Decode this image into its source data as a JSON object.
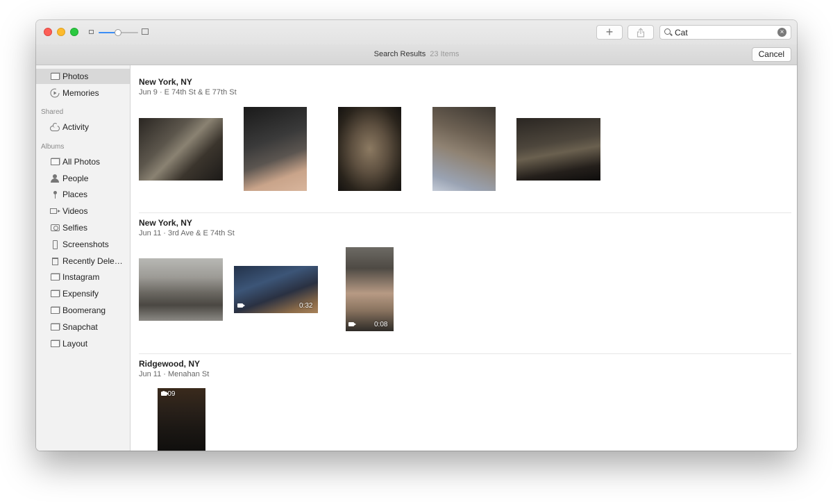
{
  "search": {
    "value": "Cat"
  },
  "header": {
    "title": "Search Results",
    "count": "23 Items",
    "cancel_label": "Cancel"
  },
  "toolbar": {
    "add_label": "+"
  },
  "sidebar": {
    "top_items": [
      {
        "label": "Photos",
        "icon": "album-icon"
      },
      {
        "label": "Memories",
        "icon": "memories-icon"
      }
    ],
    "shared_header": "Shared",
    "shared_items": [
      {
        "label": "Activity",
        "icon": "cloud-icon"
      }
    ],
    "albums_header": "Albums",
    "album_items": [
      {
        "label": "All Photos",
        "icon": "album-icon"
      },
      {
        "label": "People",
        "icon": "person-icon"
      },
      {
        "label": "Places",
        "icon": "pin-icon"
      },
      {
        "label": "Videos",
        "icon": "video-icon"
      },
      {
        "label": "Selfies",
        "icon": "camera-icon"
      },
      {
        "label": "Screenshots",
        "icon": "phone-icon"
      },
      {
        "label": "Recently Dele…",
        "icon": "trash-icon"
      },
      {
        "label": "Instagram",
        "icon": "album-icon"
      },
      {
        "label": "Expensify",
        "icon": "album-icon"
      },
      {
        "label": "Boomerang",
        "icon": "album-icon"
      },
      {
        "label": "Snapchat",
        "icon": "album-icon"
      },
      {
        "label": "Layout",
        "icon": "album-icon"
      }
    ]
  },
  "sections": [
    {
      "title": "New York, NY",
      "subtitle": "Jun 9 · E 74th St & E 77th St"
    },
    {
      "title": "New York, NY",
      "subtitle": "Jun 11 · 3rd Ave & E 74th St"
    },
    {
      "title": "Ridgewood, NY",
      "subtitle": "Jun 11 · Menahan St"
    }
  ],
  "videos": {
    "v1": "0:32",
    "v2": "0:08",
    "v3": "0:09"
  }
}
